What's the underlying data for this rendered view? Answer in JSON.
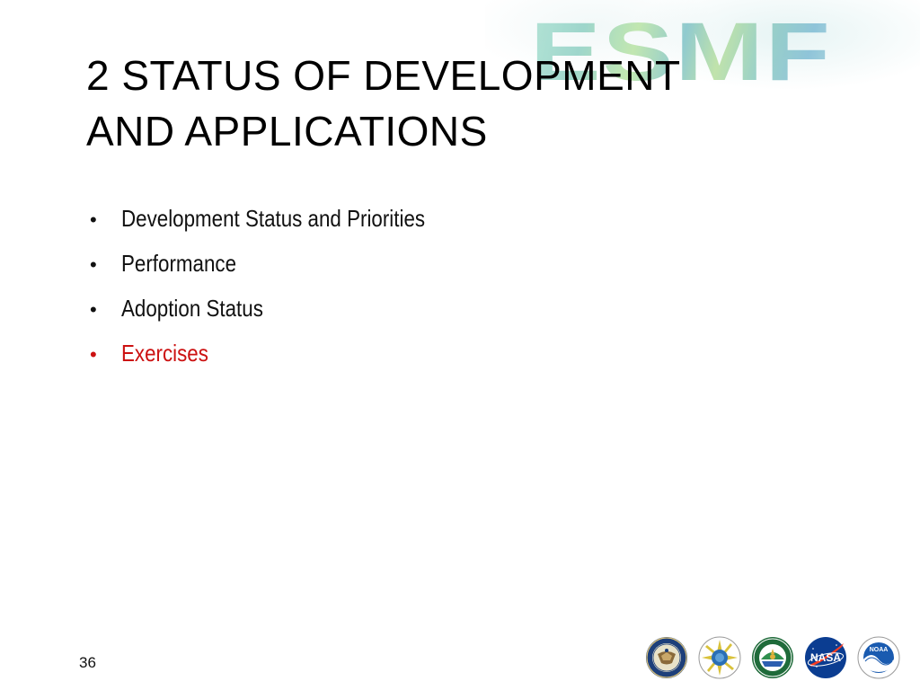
{
  "slide": {
    "logo": {
      "text": "ESMF"
    },
    "title": {
      "line1": "2 STATUS OF DEVELOPMENT",
      "line2": "AND APPLICATIONS"
    },
    "bullets": [
      {
        "label": "Development Status and Priorities",
        "active": false
      },
      {
        "label": "Performance",
        "active": false
      },
      {
        "label": "Adoption Status",
        "active": false
      },
      {
        "label": "Exercises",
        "active": true
      }
    ],
    "bullet_marker": "•",
    "page_number": "36",
    "seals": [
      {
        "icon": "department-of-defense-seal-icon"
      },
      {
        "icon": "national-science-foundation-seal-icon"
      },
      {
        "icon": "department-of-energy-seal-icon"
      },
      {
        "icon": "nasa-logo-icon",
        "text": "NASA"
      },
      {
        "icon": "noaa-logo-icon",
        "text": "NOAA"
      }
    ]
  },
  "colors": {
    "title": "#000000",
    "bullet_text": "#111111",
    "active_bullet": "#cc1111",
    "logo_tint": "#8fd0c4"
  }
}
